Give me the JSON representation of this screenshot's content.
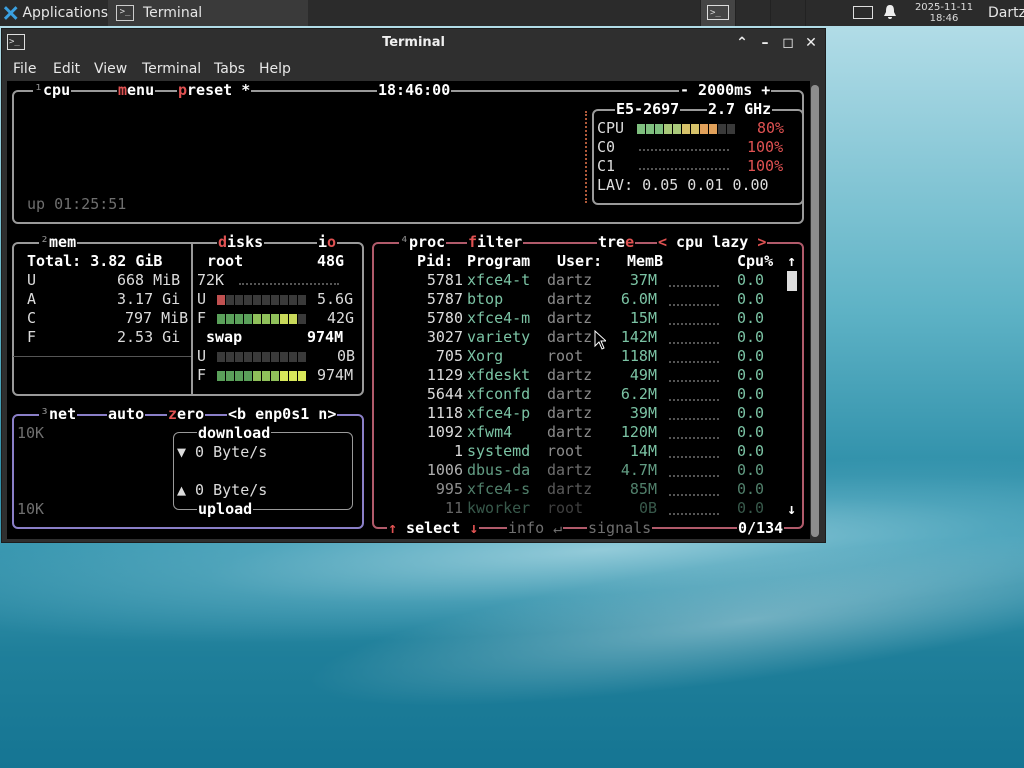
{
  "panel": {
    "apps_label": "Applications",
    "task_label": "Terminal",
    "clock_date": "2025-11-11",
    "clock_time": "18:46",
    "user": "Dartz"
  },
  "window": {
    "title": "Terminal",
    "menu": [
      "File",
      "Edit",
      "View",
      "Terminal",
      "Tabs",
      "Help"
    ]
  },
  "cpu_box": {
    "tab_num": "¹",
    "tab_cpu": "cpu",
    "tab_menu": "menu",
    "tab_preset": "preset *",
    "time": "18:46:00",
    "interval": "- 2000ms +",
    "model": "E5-2697",
    "freq": "2.7 GHz",
    "cpu_label": "CPU",
    "cpu_pct": "80%",
    "cpu_level": 0.8,
    "c0_label": "C0",
    "c0_pct": "100%",
    "c1_label": "C1",
    "c1_pct": "100%",
    "lav": "LAV: 0.05 0.01 0.00",
    "uptime": "up 01:25:51"
  },
  "mem_box": {
    "tab_num": "²",
    "tab": "mem",
    "total": "Total: 3.82 GiB",
    "rows": [
      {
        "k": "U",
        "v": "668 MiB"
      },
      {
        "k": "A",
        "v": "3.17 Gi"
      },
      {
        "k": "C",
        "v": "797 MiB"
      },
      {
        "k": "F",
        "v": "2.53 Gi"
      }
    ]
  },
  "disks_box": {
    "tab": "disks",
    "tab_io": "io",
    "root_label": "root",
    "root_size": "48G",
    "root_io": "72K",
    "root_used_label": "U",
    "root_used": "5.6G",
    "root_used_level": 0.12,
    "root_free_label": "F",
    "root_free": "42G",
    "root_free_level": 0.88,
    "swap_label": "swap",
    "swap_size": "974M",
    "swap_used_label": "U",
    "swap_used": "0B",
    "swap_used_level": 0,
    "swap_free_label": "F",
    "swap_free": "974M",
    "swap_free_level": 1
  },
  "net_box": {
    "tab_num": "³",
    "tab": "net",
    "auto": "auto",
    "zero": "zero",
    "iface": "<b enp0s1 n>",
    "scale_top": "10K",
    "scale_bottom": "10K",
    "download_label": "download",
    "download_rate": "▼ 0 Byte/s",
    "upload_rate": "▲ 0 Byte/s",
    "upload_label": "upload"
  },
  "proc_box": {
    "tab_num": "⁴",
    "tab": "proc",
    "filter": "filter",
    "tree": "tree",
    "sort": "< cpu lazy >",
    "headers": {
      "pid": "Pid:",
      "program": "Program",
      "user": "User:",
      "mem": "MemB",
      "cpu": "Cpu%"
    },
    "rows": [
      {
        "pid": "5781",
        "program": "xfce4-t",
        "user": "dartz",
        "mem": "37M",
        "cpu": "0.0"
      },
      {
        "pid": "5787",
        "program": "btop",
        "user": "dartz",
        "mem": "6.0M",
        "cpu": "0.0"
      },
      {
        "pid": "5780",
        "program": "xfce4-m",
        "user": "dartz",
        "mem": "15M",
        "cpu": "0.0"
      },
      {
        "pid": "3027",
        "program": "variety",
        "user": "dartz",
        "mem": "142M",
        "cpu": "0.0"
      },
      {
        "pid": "705",
        "program": "Xorg",
        "user": "root",
        "mem": "118M",
        "cpu": "0.0"
      },
      {
        "pid": "1129",
        "program": "xfdeskt",
        "user": "dartz",
        "mem": "49M",
        "cpu": "0.0"
      },
      {
        "pid": "5644",
        "program": "xfconfd",
        "user": "dartz",
        "mem": "6.2M",
        "cpu": "0.0"
      },
      {
        "pid": "1118",
        "program": "xfce4-p",
        "user": "dartz",
        "mem": "39M",
        "cpu": "0.0"
      },
      {
        "pid": "1092",
        "program": "xfwm4",
        "user": "dartz",
        "mem": "120M",
        "cpu": "0.0"
      },
      {
        "pid": "1",
        "program": "systemd",
        "user": "root",
        "mem": "14M",
        "cpu": "0.0"
      },
      {
        "pid": "1006",
        "program": "dbus-da",
        "user": "dartz",
        "mem": "4.7M",
        "cpu": "0.0"
      },
      {
        "pid": "995",
        "program": "xfce4-s",
        "user": "dartz",
        "mem": "85M",
        "cpu": "0.0"
      },
      {
        "pid": "11",
        "program": "kworker",
        "user": "root",
        "mem": "0B",
        "cpu": "0.0"
      }
    ],
    "footer_select": "↑ select ↓",
    "footer_info": "info ↵",
    "footer_signals": "signals",
    "count": "0/134"
  },
  "colors": {
    "border": "#9a9a9a",
    "accent_red": "#e05252",
    "program_green": "#7bc3a4",
    "panel_bg": "#2b2b2b"
  }
}
